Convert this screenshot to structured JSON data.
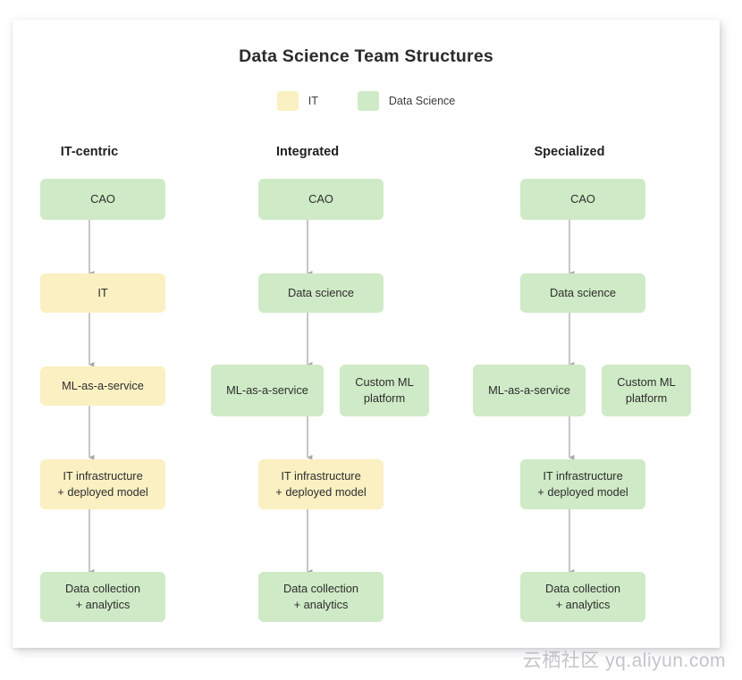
{
  "title": "Data Science Team Structures",
  "colors": {
    "it": "#fbf0c2",
    "data_science": "#cfeac6",
    "arrow": "#a8a8a8",
    "card": "#ffffff",
    "text": "#2d2d2d"
  },
  "legend": {
    "items": [
      {
        "label": "IT",
        "color": "#fbf0c2",
        "swatch_name": "legend-swatch-it"
      },
      {
        "label": "Data Science",
        "color": "#cfeac6",
        "swatch_name": "legend-swatch-data-science"
      }
    ]
  },
  "columns": [
    {
      "header": "IT-centric",
      "nodes": [
        {
          "label": "CAO",
          "type": "data_science"
        },
        {
          "label": "IT",
          "type": "it"
        },
        {
          "label": "ML-as-a-service",
          "type": "it"
        },
        {
          "label": "IT infrastructure\n+ deployed model",
          "line1": "IT infrastructure",
          "line2": "+ deployed model",
          "type": "it"
        },
        {
          "label": "Data collection\n+ analytics",
          "line1": "Data collection",
          "line2": "+ analytics",
          "type": "data_science"
        }
      ]
    },
    {
      "header": "Integrated",
      "nodes": [
        {
          "label": "CAO",
          "type": "data_science"
        },
        {
          "label": "Data science",
          "type": "data_science"
        },
        {
          "label": "ML-as-a-service",
          "type": "data_science"
        },
        {
          "label": "Custom ML\nplatform",
          "line1": "Custom ML",
          "line2": "platform",
          "type": "data_science"
        },
        {
          "label": "IT infrastructure\n+ deployed model",
          "line1": "IT infrastructure",
          "line2": "+ deployed model",
          "type": "it"
        },
        {
          "label": "Data collection\n+ analytics",
          "line1": "Data collection",
          "line2": "+ analytics",
          "type": "data_science"
        }
      ]
    },
    {
      "header": "Specialized",
      "nodes": [
        {
          "label": "CAO",
          "type": "data_science"
        },
        {
          "label": "Data science",
          "type": "data_science"
        },
        {
          "label": "ML-as-a-service",
          "type": "data_science"
        },
        {
          "label": "Custom ML\nplatform",
          "line1": "Custom ML",
          "line2": "platform",
          "type": "data_science"
        },
        {
          "label": "IT infrastructure\n+ deployed model",
          "line1": "IT infrastructure",
          "line2": "+ deployed model",
          "type": "data_science"
        },
        {
          "label": "Data collection\n+ analytics",
          "line1": "Data collection",
          "line2": "+ analytics",
          "type": "data_science"
        }
      ]
    }
  ],
  "watermark": "云栖社区 yq.aliyun.com"
}
